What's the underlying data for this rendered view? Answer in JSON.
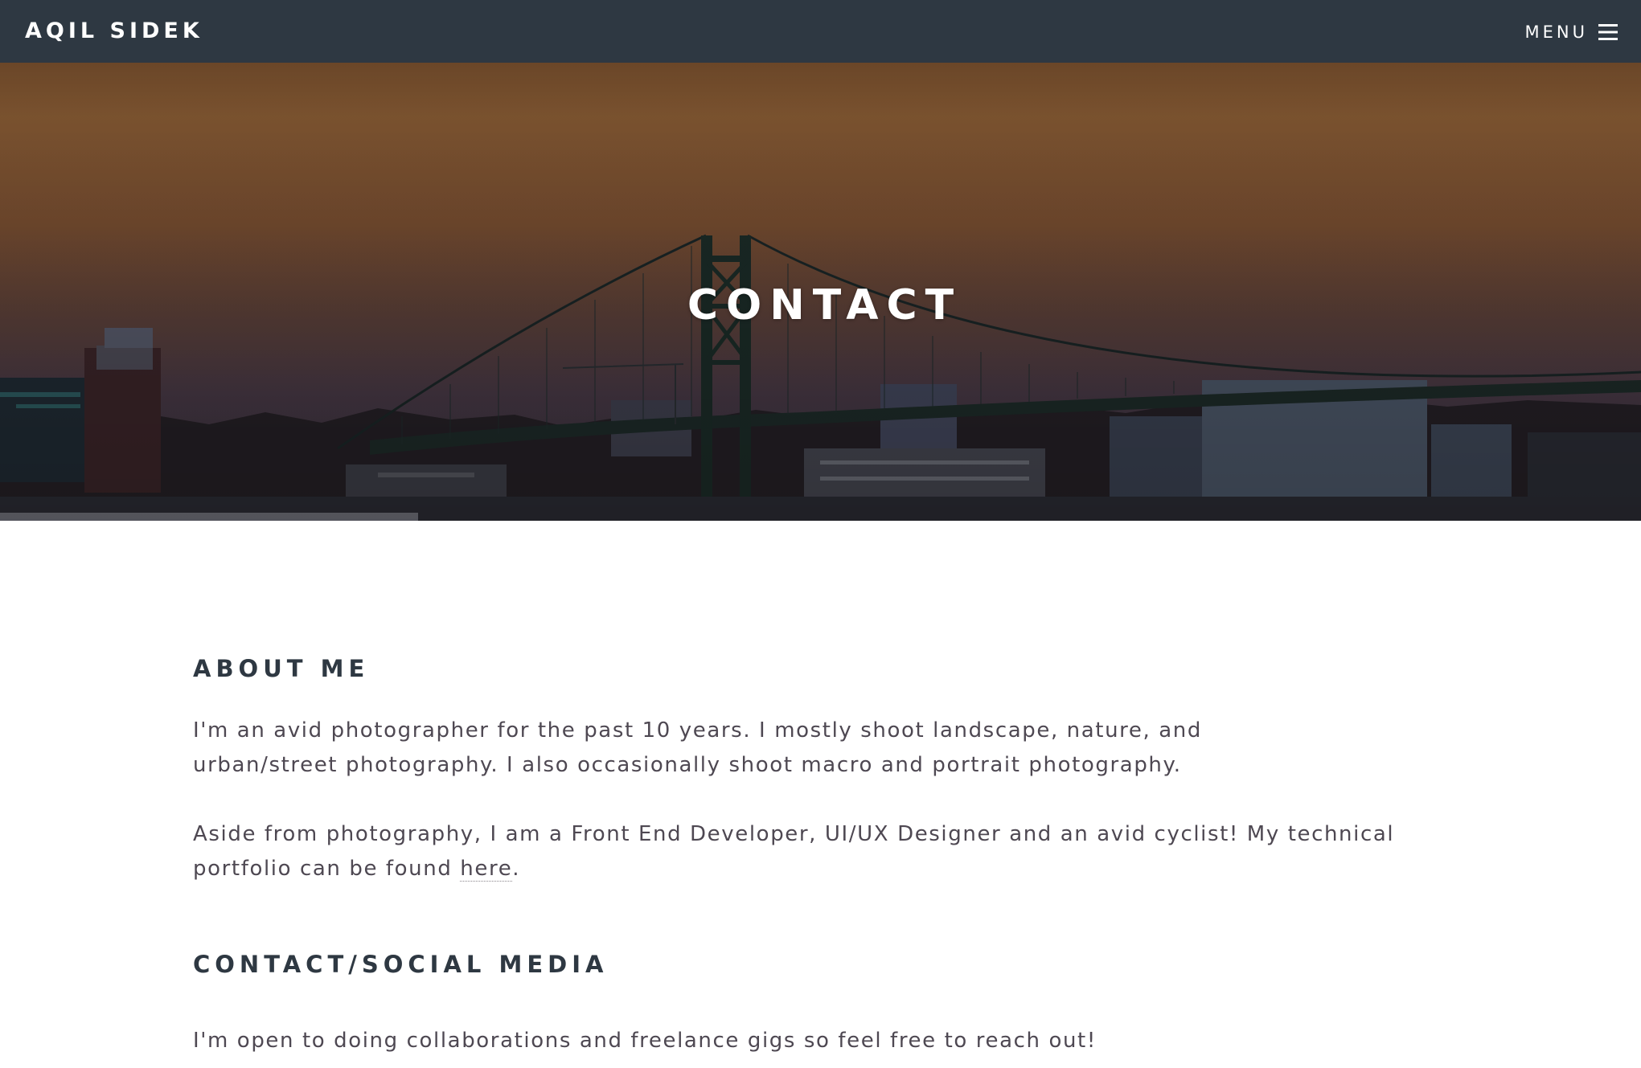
{
  "header": {
    "brand": "AQIL SIDEK",
    "menu_label": "MENU"
  },
  "banner": {
    "title": "CONTACT"
  },
  "about": {
    "heading": "ABOUT ME",
    "paragraph1": "I'm an avid photographer for the past 10 years. I mostly shoot landscape, nature, and urban/street photography. I also occasionally shoot macro and portrait photography.",
    "paragraph2_before": "Aside from photography, I am a Front End Developer, UI/UX Designer and an avid cyclist! My technical portfolio can be found ",
    "paragraph2_link": "here",
    "paragraph2_after": "."
  },
  "contact": {
    "heading": "CONTACT/SOCIAL MEDIA",
    "paragraph": "I'm open to doing collaborations and freelance gigs so feel free to reach out!"
  },
  "colors": {
    "header_bg": "#2e3842",
    "heading_text": "#2e3842",
    "body_text": "#4e4852",
    "sky_top": "#6e4a2c",
    "sky_mid": "#835a33",
    "sky_low": "#4a3a48"
  },
  "icons": {
    "menu": "hamburger-menu-icon"
  }
}
